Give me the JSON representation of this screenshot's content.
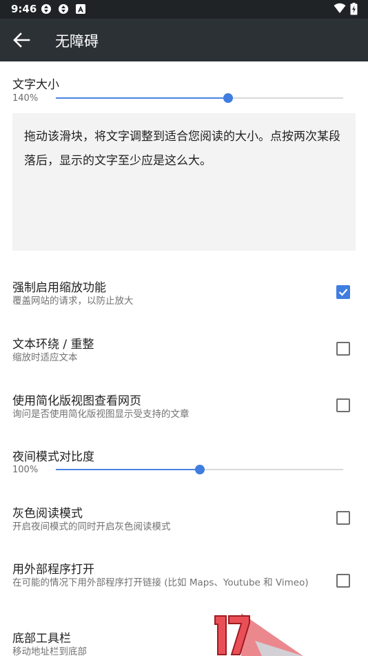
{
  "status_bar": {
    "time": "9:46",
    "icons": [
      "sync-icon",
      "sync-icon",
      "a-notification-icon"
    ],
    "right_icons": [
      "wifi-icon",
      "battery-charging-icon"
    ]
  },
  "app_bar": {
    "back_icon": "arrow-left-icon",
    "title": "无障碍"
  },
  "text_size": {
    "title": "文字大小",
    "value": "140%",
    "level": 0.6
  },
  "preview_text": "拖动该滑块，将文字调整到适合您阅读的大小。点按两次某段落后，显示的文字至少应是这么大。",
  "settings": [
    {
      "title": "强制启用缩放功能",
      "subtitle": "覆盖网站的请求，以防止放大",
      "checked": true
    },
    {
      "title": "文本环绕 / 重整",
      "subtitle": "缩放时适应文本",
      "checked": false
    },
    {
      "title": "使用简化版视图查看网页",
      "subtitle": "询问是否使用简化版视图显示受支持的文章",
      "checked": false
    }
  ],
  "night_contrast": {
    "title": "夜间模式对比度",
    "value": "100%",
    "level": 0.5
  },
  "settings2": [
    {
      "title": "灰色阅读模式",
      "subtitle": "开启夜间模式的同时开启灰色阅读模式",
      "checked": false
    },
    {
      "title": "用外部程序打开",
      "subtitle": "在可能的情况下用外部程序打开链接 (比如 Maps、Youtube 和 Vimeo)",
      "checked": false
    },
    {
      "title": "底部工具栏",
      "subtitle": "移动地址栏到底部"
    }
  ],
  "colors": {
    "accent": "#3f7de0",
    "appbar": "#2c3136",
    "statusbar": "#1f2326"
  }
}
